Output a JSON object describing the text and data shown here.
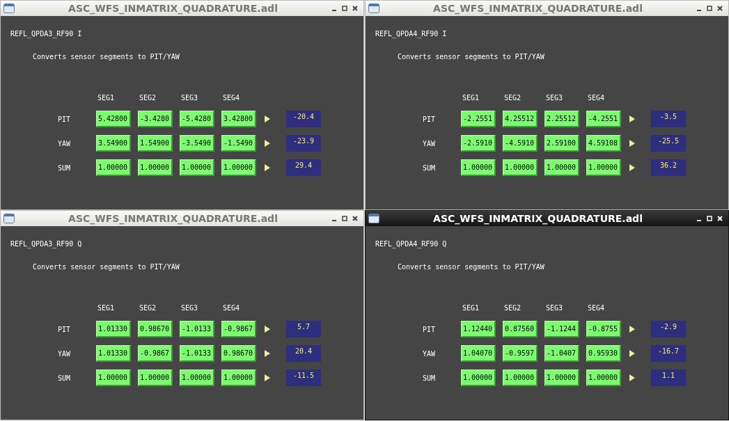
{
  "windows": [
    {
      "title": "ASC_WFS_INMATRIX_QUADRATURE.adl",
      "active": false,
      "channel": "REFL_QPDA3_RF90 I",
      "description": "Converts sensor segments to PIT/YAW",
      "columns": [
        "SEG1",
        "SEG2",
        "SEG3",
        "SEG4"
      ],
      "rows": [
        {
          "label": "PIT",
          "values": [
            "5.42800",
            "-3.4280",
            "-5.4280",
            "3.42800"
          ],
          "output": "-20.4"
        },
        {
          "label": "YAW",
          "values": [
            "3.54900",
            "1.54900",
            "-3.5490",
            "-1.5490"
          ],
          "output": "-23.9"
        },
        {
          "label": "SUM",
          "values": [
            "1.00000",
            "1.00000",
            "1.00000",
            "1.00000"
          ],
          "output": "29.4"
        }
      ]
    },
    {
      "title": "ASC_WFS_INMATRIX_QUADRATURE.adl",
      "active": false,
      "channel": "REFL_QPDA4_RF90 I",
      "description": "Converts sensor segments to PIT/YAW",
      "columns": [
        "SEG1",
        "SEG2",
        "SEG3",
        "SEG4"
      ],
      "rows": [
        {
          "label": "PIT",
          "values": [
            "-2.2551",
            "4.25512",
            "2.25512",
            "-4.2551"
          ],
          "output": "-3.5"
        },
        {
          "label": "YAW",
          "values": [
            "-2.5910",
            "-4.5910",
            "2.59100",
            "4.59108"
          ],
          "output": "-25.5"
        },
        {
          "label": "SUM",
          "values": [
            "1.00000",
            "1.00000",
            "1.00000",
            "1.00000"
          ],
          "output": "36.2"
        }
      ]
    },
    {
      "title": "ASC_WFS_INMATRIX_QUADRATURE.adl",
      "active": false,
      "channel": "REFL_QPDA3_RF90 Q",
      "description": "Converts sensor segments to PIT/YAW",
      "columns": [
        "SEG1",
        "SEG2",
        "SEG3",
        "SEG4"
      ],
      "rows": [
        {
          "label": "PIT",
          "values": [
            "1.01330",
            "0.98670",
            "-1.0133",
            "-0.9867"
          ],
          "output": "5.7"
        },
        {
          "label": "YAW",
          "values": [
            "1.01330",
            "-0.9867",
            "-1.0133",
            "0.98670"
          ],
          "output": "20.4"
        },
        {
          "label": "SUM",
          "values": [
            "1.00000",
            "1.00000",
            "1.00000",
            "1.00000"
          ],
          "output": "-11.5"
        }
      ]
    },
    {
      "title": "ASC_WFS_INMATRIX_QUADRATURE.adl",
      "active": true,
      "channel": "REFL_QPDA4_RF90 Q",
      "description": "Converts sensor segments to PIT/YAW",
      "columns": [
        "SEG1",
        "SEG2",
        "SEG3",
        "SEG4"
      ],
      "rows": [
        {
          "label": "PIT",
          "values": [
            "1.12440",
            "0.87560",
            "-1.1244",
            "-0.8755"
          ],
          "output": "-2.9"
        },
        {
          "label": "YAW",
          "values": [
            "1.04070",
            "-0.9597",
            "-1.0407",
            "0.95930"
          ],
          "output": "-16.7"
        },
        {
          "label": "SUM",
          "values": [
            "1.00000",
            "1.00000",
            "1.00000",
            "1.00000"
          ],
          "output": "1.1"
        }
      ]
    }
  ]
}
